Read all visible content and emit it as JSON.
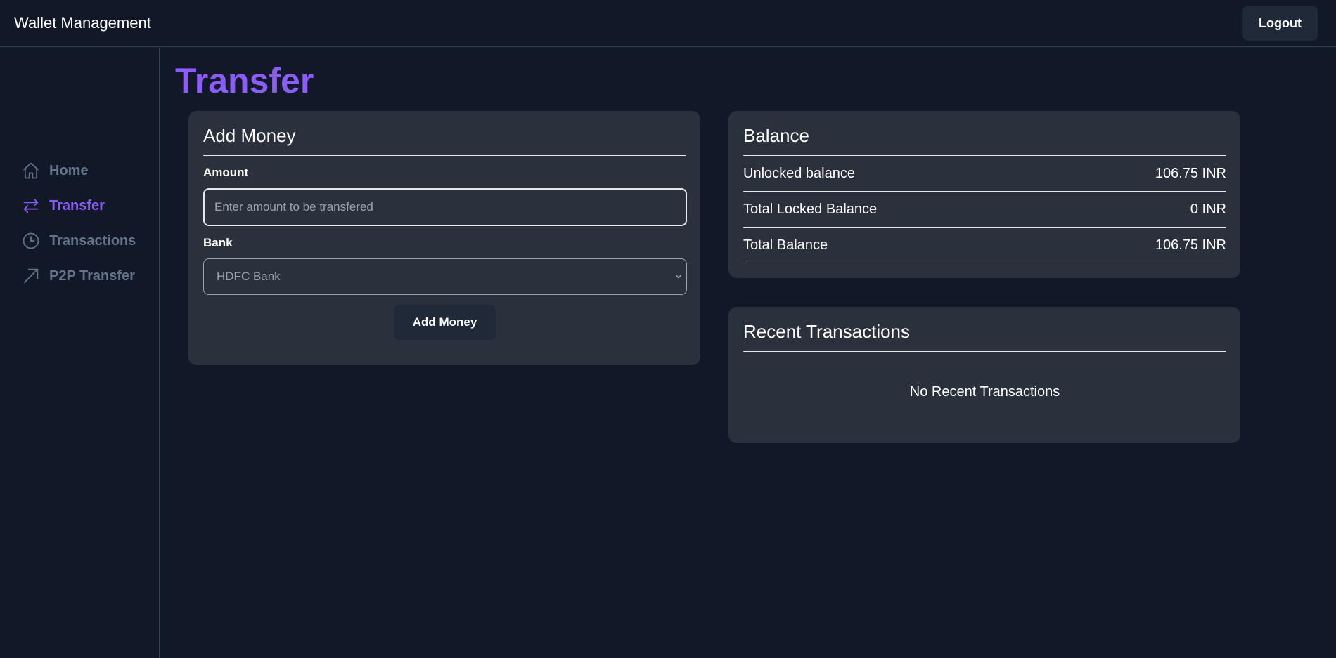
{
  "header": {
    "title": "Wallet Management",
    "logout_label": "Logout"
  },
  "sidebar": {
    "items": [
      {
        "label": "Home",
        "icon": "home-icon",
        "active": false
      },
      {
        "label": "Transfer",
        "icon": "transfer-arrows-icon",
        "active": true
      },
      {
        "label": "Transactions",
        "icon": "clock-icon",
        "active": false
      },
      {
        "label": "P2P Transfer",
        "icon": "arrow-up-right-icon",
        "active": false
      }
    ]
  },
  "page": {
    "title": "Transfer"
  },
  "add_money": {
    "title": "Add Money",
    "amount_label": "Amount",
    "amount_placeholder": "Enter amount to be transfered",
    "amount_value": "",
    "bank_label": "Bank",
    "bank_selected": "HDFC Bank",
    "button_label": "Add Money"
  },
  "balance": {
    "title": "Balance",
    "rows": [
      {
        "label": "Unlocked balance",
        "value": "106.75 INR"
      },
      {
        "label": "Total Locked Balance",
        "value": "0 INR"
      },
      {
        "label": "Total Balance",
        "value": "106.75 INR"
      }
    ]
  },
  "recent_transactions": {
    "title": "Recent Transactions",
    "empty_message": "No Recent Transactions"
  },
  "colors": {
    "background": "#111827",
    "card": "#2a303c",
    "accent": "#8b5cf6",
    "nav_inactive": "#64748b",
    "button": "#1f2937"
  }
}
